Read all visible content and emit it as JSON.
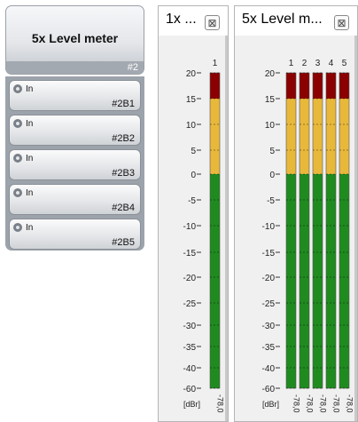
{
  "node": {
    "title": "5x Level meter",
    "id": "#2",
    "inputs": [
      {
        "label": "In",
        "name": "#2B1"
      },
      {
        "label": "In",
        "name": "#2B2"
      },
      {
        "label": "In",
        "name": "#2B3"
      },
      {
        "label": "In",
        "name": "#2B4"
      },
      {
        "label": "In",
        "name": "#2B5"
      }
    ]
  },
  "meters": {
    "scale": [
      "20",
      "15",
      "10",
      "5",
      "0",
      "-5",
      "-10",
      "-15",
      "-20",
      "-25",
      "-30",
      "-35",
      "-40",
      "-60"
    ],
    "unit": "[dBr]",
    "colors": {
      "red": "#8b0000",
      "yellow": "#e8b83a",
      "green": "#1f8b1f"
    },
    "panel1": {
      "title": "1x ...",
      "close_icon": "close-icon",
      "channels": [
        "1"
      ],
      "readings": [
        "-78,0"
      ]
    },
    "panel2": {
      "title": "5x Level m...",
      "close_icon": "close-icon",
      "channels": [
        "1",
        "2",
        "3",
        "4",
        "5"
      ],
      "readings": [
        "-78,0",
        "-78,0",
        "-78,0",
        "-78,0",
        "-78,0"
      ]
    }
  }
}
